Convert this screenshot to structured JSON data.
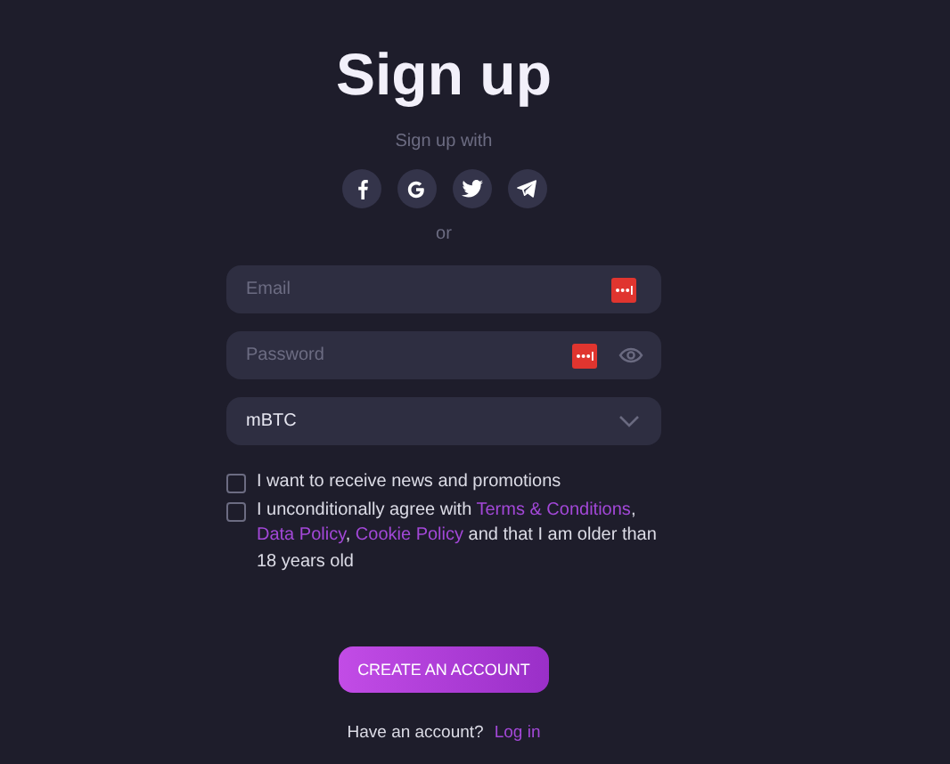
{
  "title": "Sign up",
  "social": {
    "label": "Sign up with",
    "buttons": [
      {
        "kind": "facebook"
      },
      {
        "kind": "google"
      },
      {
        "kind": "twitter"
      },
      {
        "kind": "telegram"
      }
    ]
  },
  "separator": "or",
  "fields": [
    {
      "kind": "email",
      "placeholder": "Email",
      "autofill": true
    },
    {
      "kind": "password",
      "placeholder": "Password",
      "autofill": true
    },
    {
      "kind": "select",
      "value": "mBTC"
    }
  ],
  "checkboxes": [
    {
      "checked": false,
      "parts": [
        {
          "kind": "text",
          "text": "I want to receive news and promotions"
        }
      ]
    },
    {
      "checked": false,
      "parts": [
        {
          "kind": "text",
          "text": "I unconditionally agree with "
        },
        {
          "kind": "link",
          "text": "Terms & Conditions"
        },
        {
          "kind": "text",
          "text": ", "
        },
        {
          "kind": "link",
          "text": "Data Policy"
        },
        {
          "kind": "text",
          "text": ", "
        },
        {
          "kind": "link",
          "text": "Cookie Policy"
        },
        {
          "kind": "text",
          "text": " and that I am older than 18 years old"
        }
      ]
    }
  ],
  "submit": "CREATE AN ACCOUNT",
  "login": {
    "text": "Have an account?",
    "link": "Log in"
  }
}
